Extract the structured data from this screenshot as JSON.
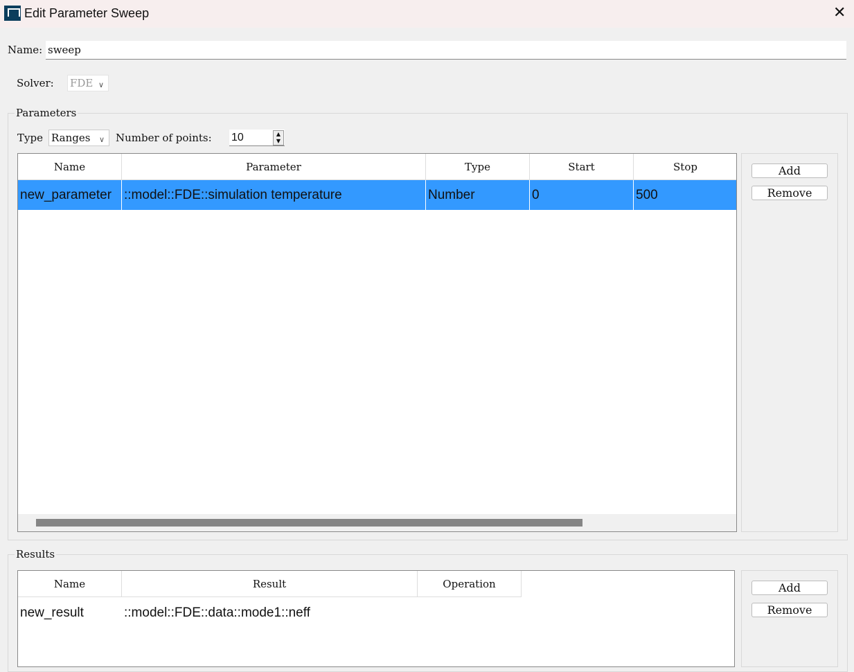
{
  "window": {
    "title": "Edit Parameter Sweep"
  },
  "name": {
    "label": "Name:",
    "value": "sweep"
  },
  "solver": {
    "label": "Solver:",
    "value": "FDE"
  },
  "parameters": {
    "title": "Parameters",
    "type_label": "Type",
    "type_value": "Ranges",
    "points_label": "Number of points:",
    "points_value": "10",
    "columns": [
      "Name",
      "Parameter",
      "Type",
      "Start",
      "Stop"
    ],
    "rows": [
      [
        "new_parameter",
        "::model::FDE::simulation temperature",
        "Number",
        "0",
        "500"
      ]
    ],
    "add": "Add",
    "remove": "Remove"
  },
  "results": {
    "title": "Results",
    "columns": [
      "Name",
      "Result",
      "Operation"
    ],
    "rows": [
      [
        "new_result",
        "::model::FDE::data::mode1::neff",
        ""
      ]
    ],
    "add": "Add",
    "remove": "Remove"
  }
}
